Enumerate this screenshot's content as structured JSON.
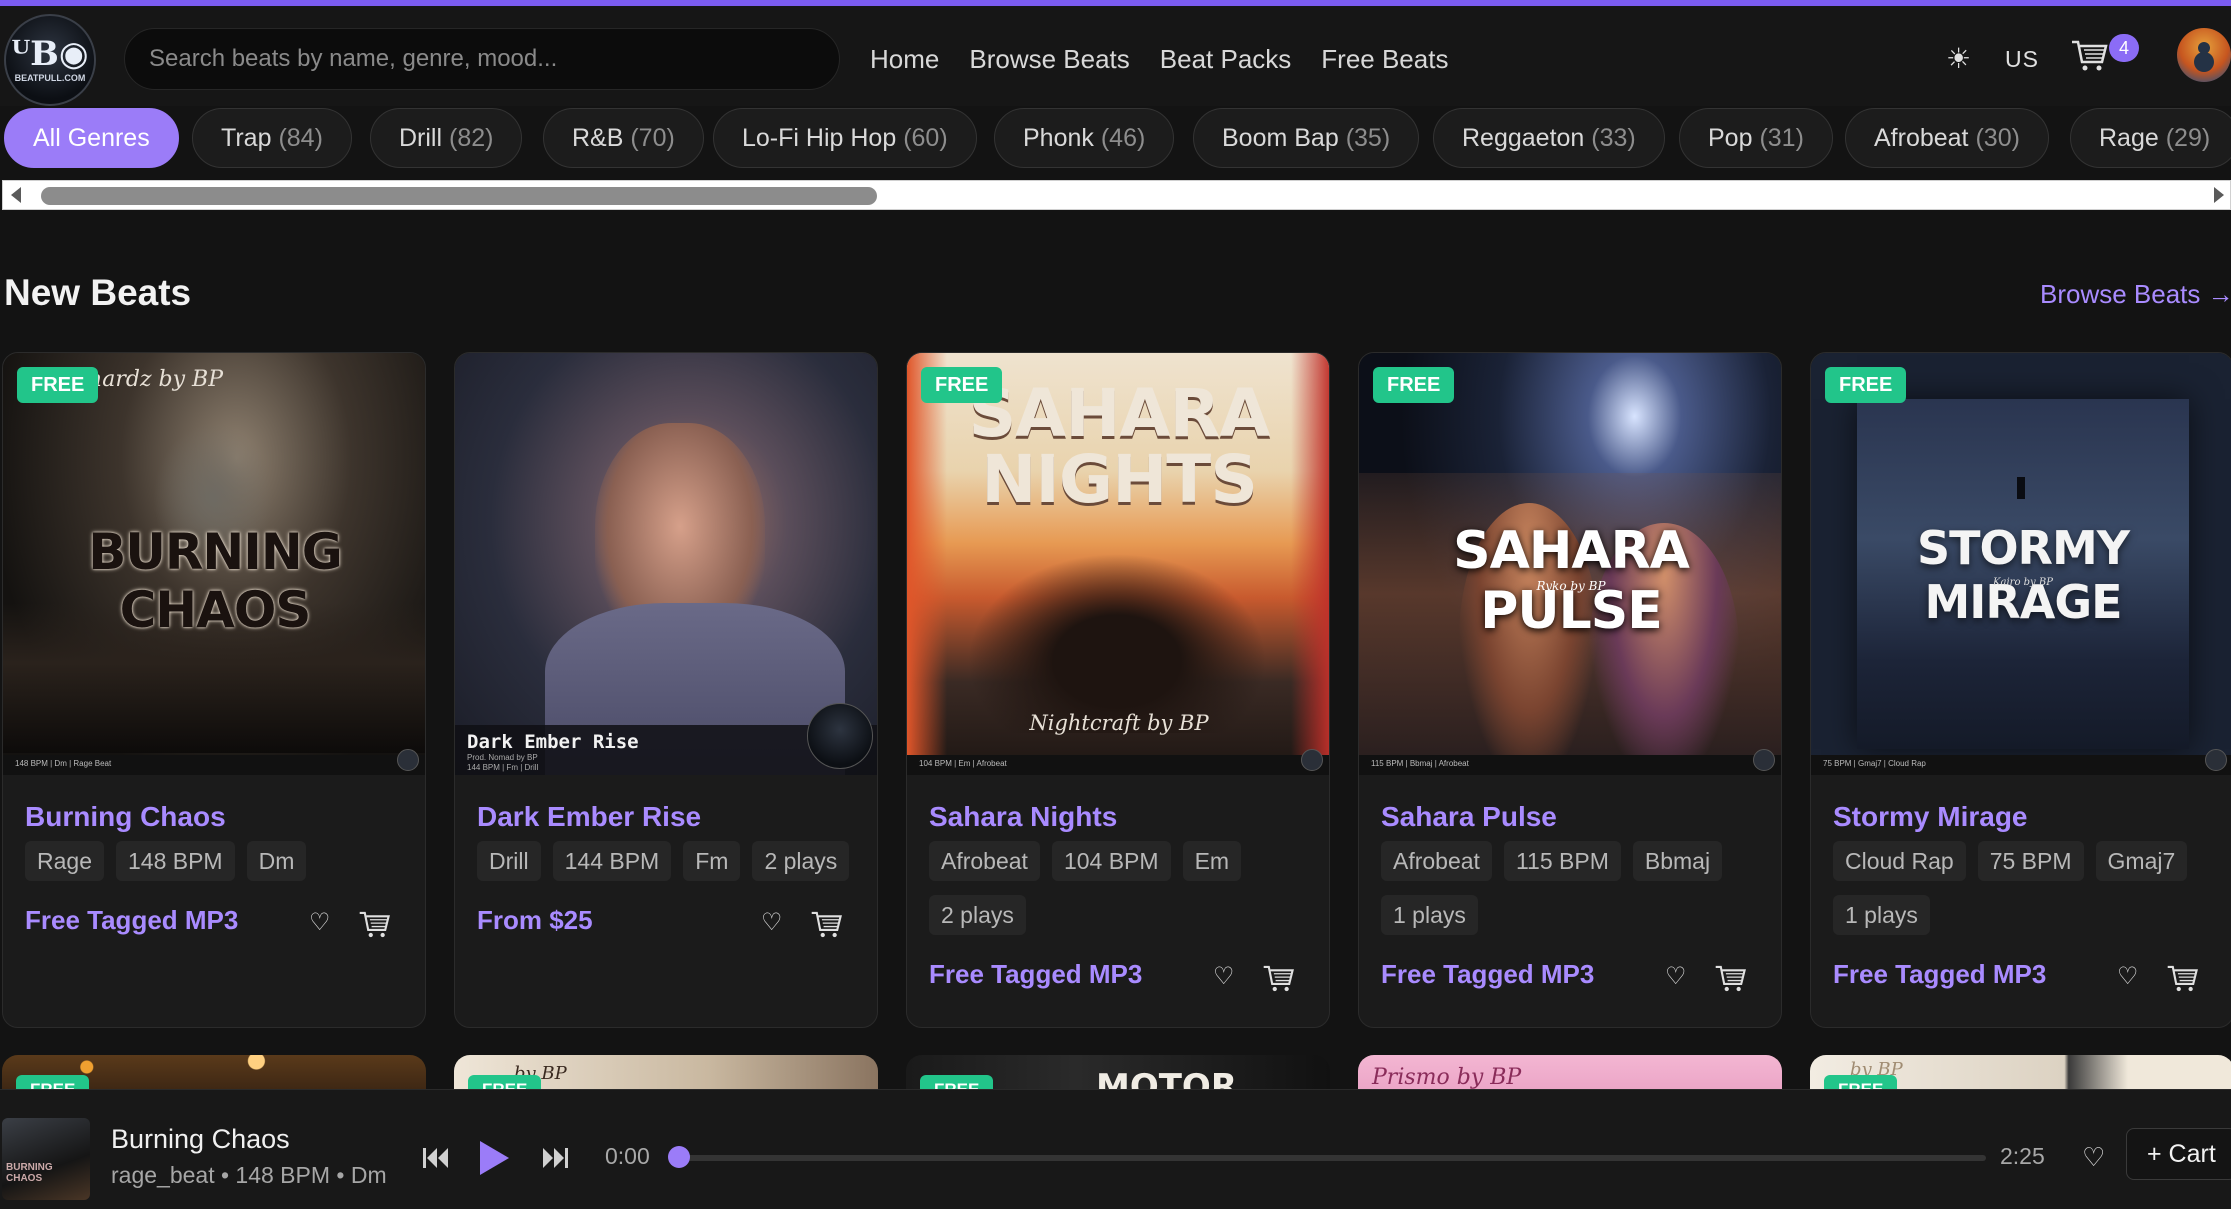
{
  "header": {
    "logo_text": "BEATPULL.COM",
    "search_placeholder": "Search beats by name, genre, mood...",
    "nav": [
      "Home",
      "Browse Beats",
      "Beat Packs",
      "Free Beats"
    ],
    "region": "US",
    "cart_count": "4",
    "accent_color": "#7b5cf0"
  },
  "genres": [
    {
      "name": "All Genres",
      "count": ""
    },
    {
      "name": "Trap",
      "count": "(84)"
    },
    {
      "name": "Drill",
      "count": "(82)"
    },
    {
      "name": "R&B",
      "count": "(70)"
    },
    {
      "name": "Lo-Fi Hip Hop",
      "count": "(60)"
    },
    {
      "name": "Phonk",
      "count": "(46)"
    },
    {
      "name": "Boom Bap",
      "count": "(35)"
    },
    {
      "name": "Reggaeton",
      "count": "(33)"
    },
    {
      "name": "Pop",
      "count": "(31)"
    },
    {
      "name": "Afrobeat",
      "count": "(30)"
    },
    {
      "name": "Rage",
      "count": "(29)"
    }
  ],
  "section": {
    "title": "New Beats",
    "link": "Browse Beats →"
  },
  "cards": [
    {
      "badge": "FREE",
      "art_title": "BURNING CHAOS",
      "art_sub": "Shardz by BP",
      "art_strip": "148 BPM | Dm | Rage Beat",
      "title": "Burning Chaos",
      "tags": [
        "Rage",
        "148 BPM",
        "Dm"
      ],
      "price": "Free Tagged MP3"
    },
    {
      "badge": "",
      "art_title": "Dark Ember Rise",
      "art_sub": "Prod. Nomad by BP",
      "art_strip": "144 BPM | Fm | Drill",
      "title": "Dark Ember Rise",
      "tags": [
        "Drill",
        "144 BPM",
        "Fm",
        "2 plays"
      ],
      "price": "From $25"
    },
    {
      "badge": "FREE",
      "art_title": "SAHARA NIGHTS",
      "art_sub": "Nightcraft by BP",
      "art_strip": "104 BPM | Em | Afrobeat",
      "title": "Sahara Nights",
      "tags": [
        "Afrobeat",
        "104 BPM",
        "Em",
        "2 plays"
      ],
      "price": "Free Tagged MP3"
    },
    {
      "badge": "FREE",
      "art_title": "SAHARA PULSE",
      "art_sub": "Ryko by BP",
      "art_strip": "115 BPM | Bbmaj | Afrobeat",
      "title": "Sahara Pulse",
      "tags": [
        "Afrobeat",
        "115 BPM",
        "Bbmaj",
        "1 plays"
      ],
      "price": "Free Tagged MP3"
    },
    {
      "badge": "FREE",
      "art_title": "STORMY MIRAGE",
      "art_sub": "Kairo by BP",
      "art_strip": "75 BPM | Gmaj7 | Cloud Rap",
      "title": "Stormy Mirage",
      "tags": [
        "Cloud Rap",
        "75 BPM",
        "Gmaj7",
        "1 plays"
      ],
      "price": "Free Tagged MP3"
    }
  ],
  "peek_cards": [
    {
      "badge": "FREE",
      "label": ""
    },
    {
      "badge": "FREE",
      "label": "by BP"
    },
    {
      "badge": "FREE",
      "label": "MOTOR CITY"
    },
    {
      "badge": "",
      "label": "Prismo by BP"
    },
    {
      "badge": "FREE",
      "label": "by BP"
    }
  ],
  "player": {
    "title": "Burning Chaos",
    "meta": "rage_beat • 148 BPM • Dm",
    "current_time": "0:00",
    "duration": "2:25",
    "progress": 0,
    "cart_label": "+ Cart"
  }
}
